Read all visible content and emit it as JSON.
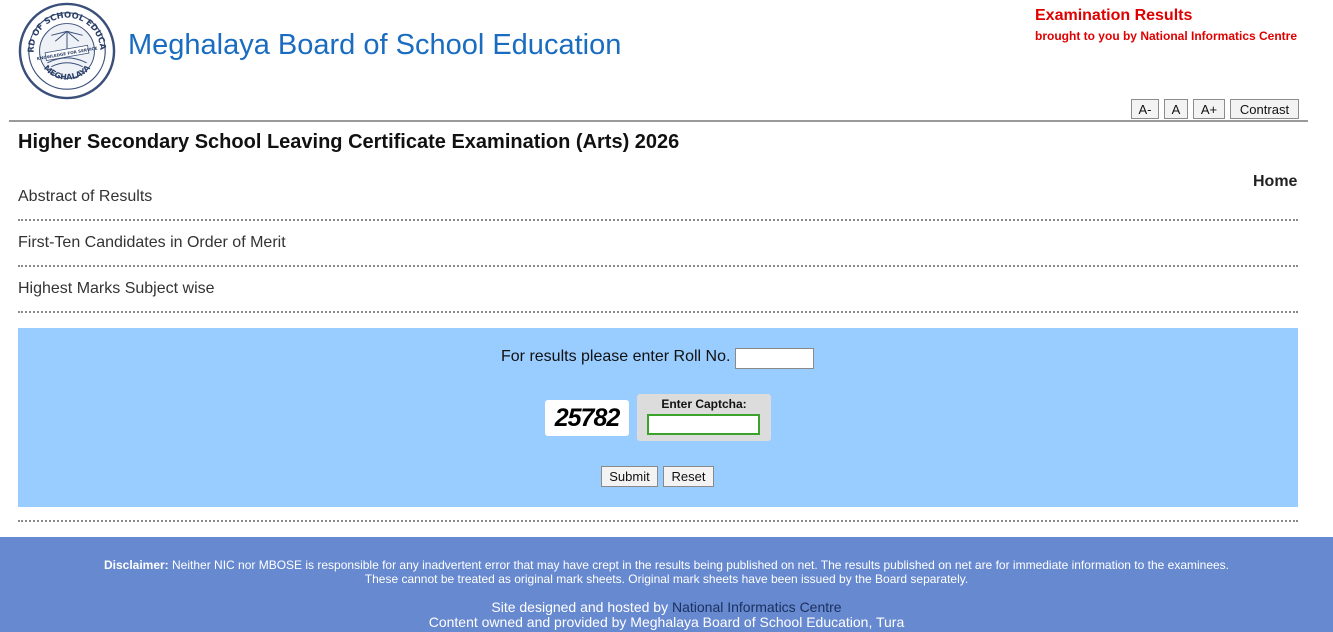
{
  "header": {
    "site_title": "Meghalaya Board of School Education",
    "exam_results": "Examination Results",
    "brought_by": "brought to you by National Informatics Centre",
    "logo": {
      "ring_text_top": "BOARD OF SCHOOL EDUCATION",
      "motto": "KNOWLEDGE FOR SERVICE",
      "ring_text_bottom": "MEGHALAYA"
    }
  },
  "accessibility": {
    "font_decrease": "A-",
    "font_normal": "A",
    "font_increase": "A+",
    "contrast": "Contrast"
  },
  "page": {
    "title": "Higher Secondary School Leaving Certificate Examination (Arts) 2026",
    "home": "Home"
  },
  "menu": [
    {
      "label": "Abstract of Results"
    },
    {
      "label": "First-Ten Candidates in Order of Merit"
    },
    {
      "label": "Highest Marks Subject wise"
    }
  ],
  "form": {
    "roll_label": "For results please enter Roll No.",
    "roll_value": "",
    "captcha_code": "25782",
    "captcha_label": "Enter Captcha:",
    "captcha_value": "",
    "submit": "Submit",
    "reset": "Reset"
  },
  "footer": {
    "disclaimer_label": "Disclaimer:",
    "disclaimer_text": "Neither NIC nor MBOSE is responsible for any inadvertent error that may have crept in the results being published on net. The results published on net are for immediate information to the examinees.",
    "disclaimer_text2": "These cannot be treated as original mark sheets. Original mark sheets have been issued by the Board separately.",
    "hosted_prefix": "Site designed and hosted by",
    "hosted_link": "National Informatics Centre",
    "content_owned": "Content owned and provided by Meghalaya Board of School Education, Tura"
  },
  "colors": {
    "title_blue": "#1a6cc0",
    "red": "#e00000",
    "panel": "#99ccff",
    "footer": "#6789cf"
  }
}
